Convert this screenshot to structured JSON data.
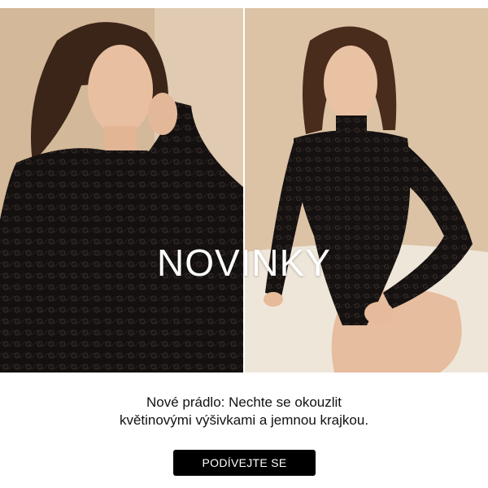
{
  "hero": {
    "title": "NOVINKY",
    "left_image": {
      "alt": "model-in-black-lace-turtleneck-bodysuit-seated"
    },
    "right_image": {
      "alt": "model-in-black-lace-bodysuit-kneeling-on-rug"
    }
  },
  "tagline": {
    "line1": "Nové prádlo: Nechte se okouzlit",
    "line2": "květinovými výšivkami a jemnou krajkou."
  },
  "cta": {
    "label": "PODÍVEJTE SE"
  },
  "colors": {
    "background": "#ffffff",
    "cta_background": "#000000",
    "cta_text": "#ffffff",
    "text": "#111111",
    "hero_title": "#ffffff",
    "backdrop_beige": "#d8bfa2"
  }
}
